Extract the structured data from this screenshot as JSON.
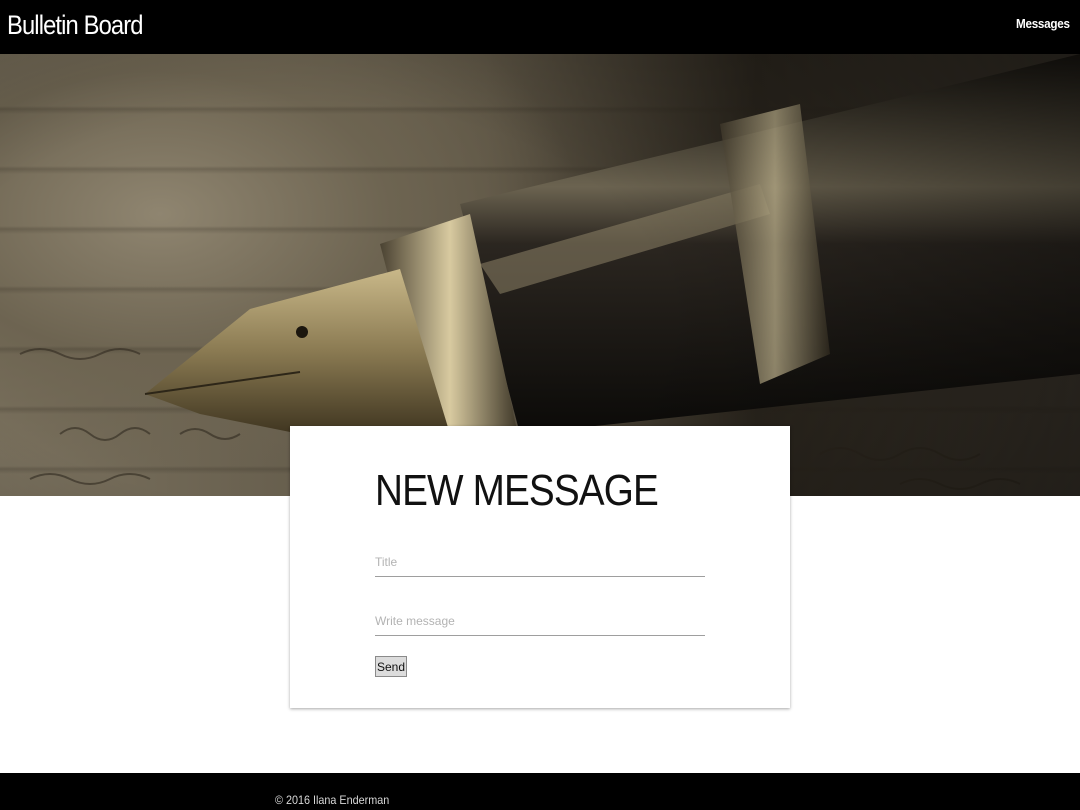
{
  "header": {
    "brand": "Bulletin Board",
    "nav": [
      {
        "label": "Messages"
      }
    ]
  },
  "hero": {
    "image": "fountain-pen-photo"
  },
  "form": {
    "heading": "NEW MESSAGE",
    "title_field": {
      "placeholder": "Title",
      "value": ""
    },
    "message_field": {
      "placeholder": "Write message",
      "value": ""
    },
    "send_label": "Send"
  },
  "footer": {
    "copyright": "© 2016 Ilana Enderman"
  },
  "colors": {
    "header_bg": "#000000",
    "footer_bg": "#000000",
    "card_bg": "#ffffff"
  }
}
